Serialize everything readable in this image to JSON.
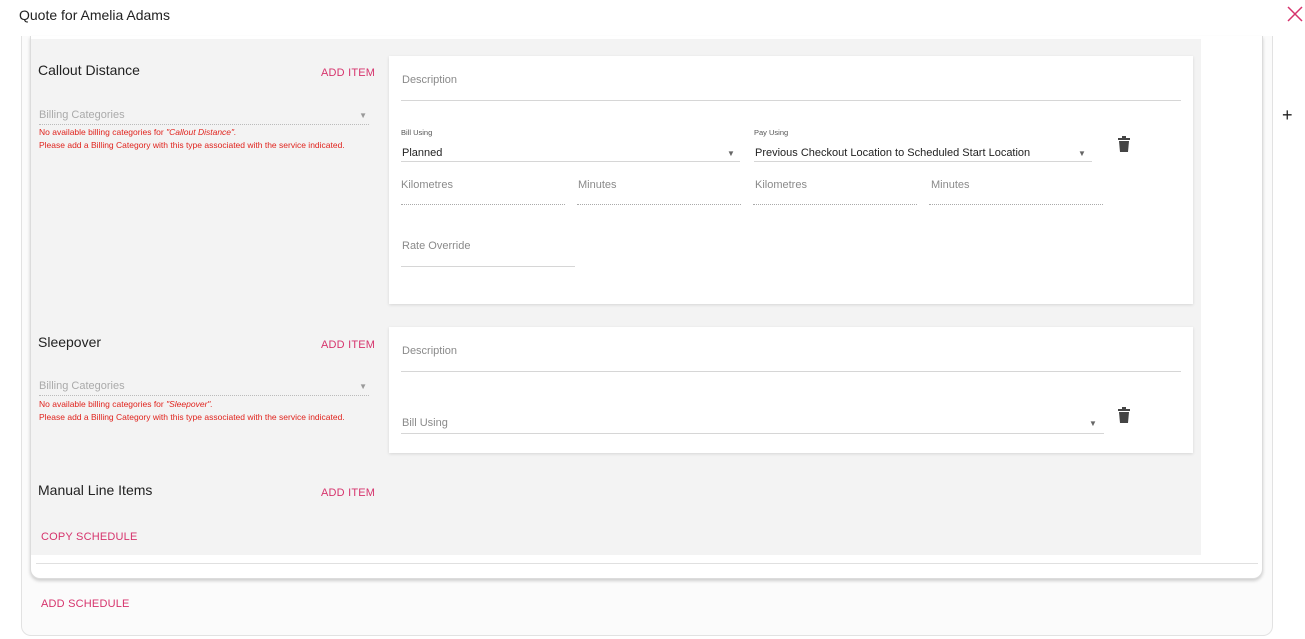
{
  "dialog": {
    "title": "Quote for Amelia Adams",
    "close_icon": "close-icon",
    "add_icon": "plus-icon"
  },
  "sections": {
    "callout": {
      "title": "Callout Distance",
      "add_item": "ADD ITEM",
      "billing_placeholder": "Billing Categories",
      "error_prefix": "No available billing categories for ",
      "error_type": "\"Callout Distance\".",
      "error_line2": "Please add a Billing Category with this type associated with the service indicated.",
      "description_placeholder": "Description",
      "bill_using_label": "Bill Using",
      "bill_using_value": "Planned",
      "pay_using_label": "Pay Using",
      "pay_using_value": "Previous Checkout Location to Scheduled Start Location",
      "bill_km_label": "Kilometres",
      "bill_min_label": "Minutes",
      "pay_km_label": "Kilometres",
      "pay_min_label": "Minutes",
      "rate_override_label": "Rate Override"
    },
    "sleepover": {
      "title": "Sleepover",
      "add_item": "ADD ITEM",
      "billing_placeholder": "Billing Categories",
      "error_prefix": "No available billing categories for ",
      "error_type": "\"Sleepover\".",
      "error_line2": "Please add a Billing Category with this type associated with the service indicated.",
      "description_placeholder": "Description",
      "bill_using_placeholder": "Bill Using"
    },
    "manual": {
      "title": "Manual Line Items",
      "add_item": "ADD ITEM"
    }
  },
  "actions": {
    "copy_schedule": "COPY SCHEDULE",
    "add_schedule": "ADD SCHEDULE"
  },
  "colors": {
    "accent": "#d6336c",
    "error": "#e0231d",
    "panel": "#f3f3f3"
  }
}
